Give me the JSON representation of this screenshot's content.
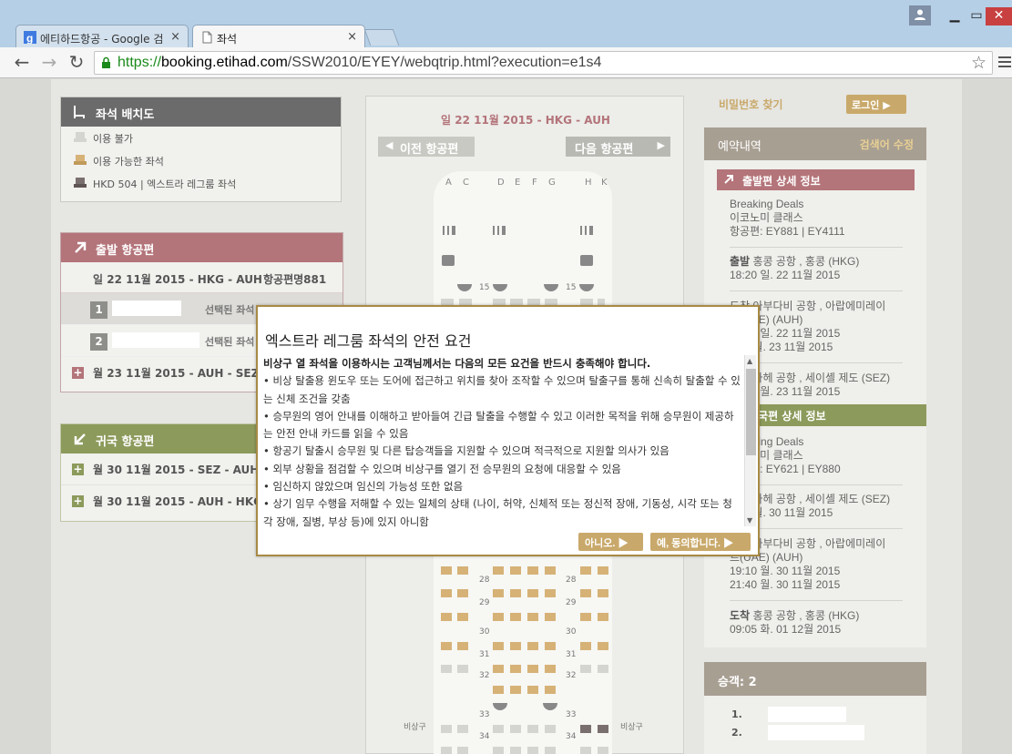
{
  "browser": {
    "tabs": [
      {
        "title": "에티하드항공 - Google 검",
        "active": false
      },
      {
        "title": "좌석",
        "active": true
      }
    ],
    "url_scheme": "https://",
    "url_host": "booking.etihad.com",
    "url_path": "/SSW2010/EYEY/webqtrip.html?execution=e1s4",
    "close_glyph": "×"
  },
  "legend": {
    "title": "좌석 배치도",
    "items": [
      {
        "label": "이용 불가",
        "color": "#d4d4d0"
      },
      {
        "label": "이용 가능한 좌석",
        "color": "#d6b277"
      },
      {
        "label": "HKD 504 | 엑스트라 레그룸 좌석",
        "color": "#7a6f6f"
      }
    ]
  },
  "outbound": {
    "title": "출발 항공편",
    "flight_date": "일 22 11월 2015 - HKG - AUH",
    "flight_number": "항공편명881",
    "passengers": [
      {
        "num": "1",
        "status": "선택된 좌석"
      },
      {
        "num": "2",
        "status": "선택된 좌석"
      }
    ],
    "next_leg": "월 23 11월 2015 - AUH - SEZ"
  },
  "return": {
    "title": "귀국 항공편",
    "legs": [
      "월 30 11월 2015 - SEZ - AUH",
      "월 30 11월 2015 - AUH - HKG"
    ]
  },
  "seatmap": {
    "date_route": "일 22 11월 2015 - HKG - AUH",
    "prev_label": "이전 항공편",
    "next_label": "다음 항공편",
    "columns": [
      "A",
      "C",
      "D",
      "E",
      "F",
      "G",
      "H",
      "K"
    ],
    "rows": [
      "15",
      "28",
      "29",
      "30",
      "31",
      "32",
      "33",
      "34"
    ],
    "exit_label": "비상구"
  },
  "sidebar": {
    "forgot_pw": "비밀번호 찾기",
    "login": "로그인",
    "reservation": "예약내역",
    "search_modify": "검색어 수정",
    "outbound_detail_title": "출발편 상세 정보",
    "out_fare": "Breaking Deals",
    "out_cabin": "이코노미 클래스",
    "out_flights": "항공편: EY881 | EY4111",
    "out_dep_label": "출발",
    "out_dep_place": "홍콩 공항 , 홍콩 (HKG)",
    "out_dep_time": "18:20 일. 22 11월 2015",
    "out_arr_line1": "도착 아부다비 공항 , 아랍에미레이",
    "out_arr_line2": "트(UAE) (AUH)",
    "out_arr_time1": "23:55 일. 22 11월 2015",
    "out_arr_time2": "도착 월. 23 11월 2015",
    "out_sez_line": "도착 마헤 공항 , 세이셸 제도 (SEZ)",
    "out_sez_time": "14:55 월. 23 11월 2015",
    "return_detail_title": "귀국편 상세 정보",
    "ret_fare": "Breaking Deals",
    "ret_cabin": "이코노미 클래스",
    "ret_flights": "항공편: EY621 | EY880",
    "ret_dep_line": "출발 마헤 공항 , 세이셸 제도 (SEZ)",
    "ret_dep_time": "출발 월. 30 11월 2015",
    "ret_arr_line1": "도착 아부다비 공항 , 아랍에미레이",
    "ret_arr_line2": "트(UAE) (AUH)",
    "ret_arr_time1": "19:10 월. 30 11월 2015",
    "ret_arr_time2": "21:40 월. 30 11월 2015",
    "ret_final_label": "도착",
    "ret_final_place": "홍콩 공항 , 홍콩 (HKG)",
    "ret_final_time": "09:05 화. 01 12월 2015",
    "pax_count": "승객: 2",
    "pax_list": [
      "1.",
      "2."
    ]
  },
  "modal": {
    "title": "엑스트라 레그룸 좌석의 안전 요건",
    "intro": "비상구 열 좌석을 이용하시는 고객님께서는 다음의 모든 요건을 반드시 충족해야 합니다.",
    "items": [
      "• 비상 탈출용 윈도우 또는 도어에 접근하고 위치를 찾아 조작할 수 있으며 탈출구를 통해 신속히 탈출할 수 있는 신체 조건을 갖춤",
      "• 승무원의 영어 안내를 이해하고 받아들여 긴급 탈출을 수행할 수 있고 이러한 목적을 위해 승무원이 제공하는 안전 안내 카드를 읽을 수 있음",
      "• 항공기 탈출시 승무원 및 다른 탑승객들을 지원할 수 있으며 적극적으로 지원할 의사가 있음",
      "• 외부 상황을 점검할 수 있으며 비상구를 열기 전 승무원의 요청에 대응할 수 있음",
      "• 임신하지 않았으며 임신의 가능성 또한 없음",
      "• 상기 임무 수행을 저해할 수 있는 일체의 상태 (나이, 허약, 신체적 또는 정신적 장애, 기동성, 시각 또는 청각 장애, 질병, 부상 등)에 있지 아니함"
    ],
    "no_label": "아니오.",
    "yes_label": "예, 동의합니다."
  },
  "colors": {
    "outbound": "#b3747a",
    "return": "#8c9a5b",
    "gold": "#c9a96b",
    "taupe": "#a89f93"
  }
}
